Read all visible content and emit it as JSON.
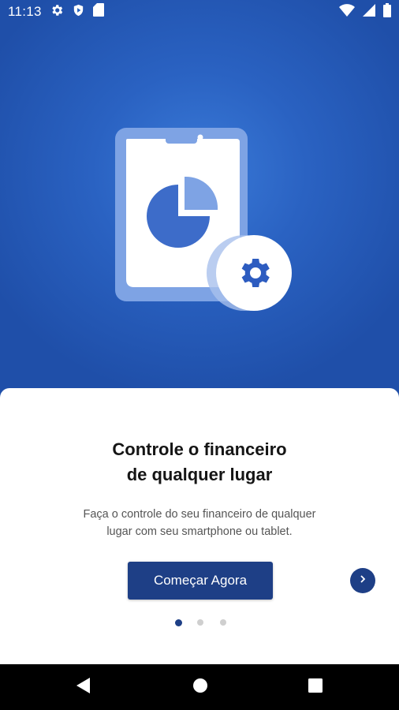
{
  "status_bar": {
    "time": "11:13",
    "left_icons": [
      "gear-icon",
      "shield-play-icon",
      "sd-card-icon"
    ],
    "right_icons": [
      "wifi-icon",
      "signal-icon",
      "battery-icon"
    ]
  },
  "illustration": {
    "icon": "tablet-pie-chart-gear-icon",
    "colors": {
      "tablet": "#7ea3e4",
      "screen": "#ffffff",
      "chart": "#3d6cc9",
      "gear_circle": "#ffffff",
      "gear": "#2d5cc0"
    }
  },
  "onboarding": {
    "title_line1": "Controle o financeiro",
    "title_line2": "de qualquer lugar",
    "subtitle_line1": "Faça o controle do seu financeiro de qualquer",
    "subtitle_line2": "lugar com seu smartphone ou tablet.",
    "cta_label": "Começar Agora",
    "next_icon": "chevron-right-icon",
    "page_indicator": {
      "current": 1,
      "total": 3
    }
  },
  "nav_bar": {
    "buttons": [
      "back-icon",
      "home-icon",
      "recents-icon"
    ]
  },
  "colors": {
    "primary": "#1e3f86",
    "hero_bg": "#2a62c2"
  }
}
